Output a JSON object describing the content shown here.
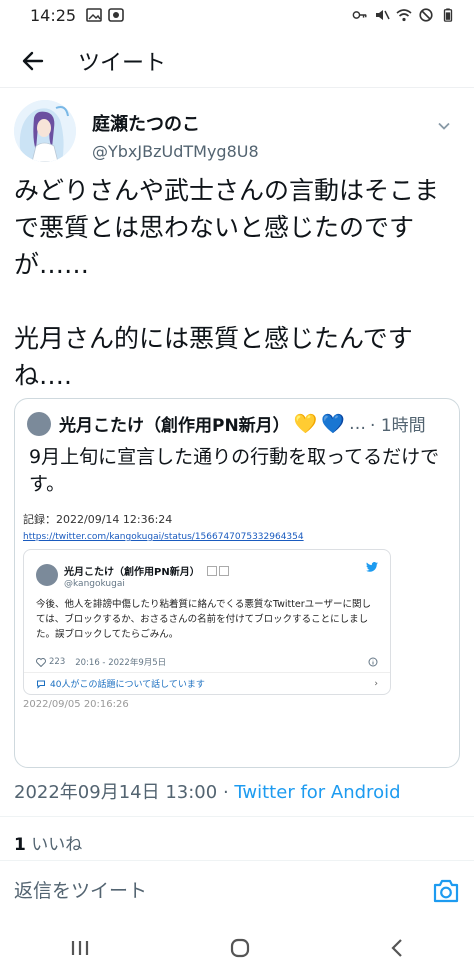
{
  "status": {
    "time": "14:25",
    "left_icons": [
      "image-icon",
      "app-icon"
    ],
    "right_icons": [
      "key-icon",
      "mute-icon",
      "wifi-icon",
      "dnd-icon",
      "battery-icon"
    ]
  },
  "header": {
    "title": "ツイート"
  },
  "author": {
    "name": "庭瀬たつのこ",
    "handle": "@YbxJBzUdTMyg8U8"
  },
  "tweet": {
    "text": "みどりさんや武士さんの言動はそこまで悪質とは思わないと感じたのですが……\n\n光月さん的には悪質と感じたんですね…."
  },
  "quote": {
    "name": "光月こたけ（創作用PN新月）",
    "emoji": [
      "💛",
      "💙"
    ],
    "dots": "…",
    "time": "· 1時間",
    "text": "9月上旬に宣言した通りの行動を取ってるだけです。",
    "screenshot": {
      "record": "記録：2022/09/14 12:36:24",
      "url": "https://twitter.com/kangokugai/status/1566747075332964354",
      "embed": {
        "name": "光月こたけ（創作用PN新月）",
        "handle": "@kangokugai",
        "text": "今後、他人を誹謗中傷したり粘着質に絡んでくる悪質なTwitterユーザーに関しては、ブロックするか、おさるさんの名前を付けてブロックすることにしました。誤ブロックしてたらごみん。",
        "likes": "223",
        "datetime": "20:16 - 2022年9月5日",
        "talk": "40人がこの話題について話しています"
      },
      "captured": "2022/09/05 20:16:26"
    }
  },
  "meta": {
    "timestamp": "2022年09月14日 13:00",
    "sep": " · ",
    "source": "Twitter for Android",
    "likes_count": "1",
    "likes_label": "いいね"
  },
  "reply": {
    "placeholder": "返信をツイート"
  },
  "colors": {
    "accent": "#1d9bf0",
    "text": "#0f1419",
    "secondary": "#536471",
    "border": "#cfd9de"
  }
}
